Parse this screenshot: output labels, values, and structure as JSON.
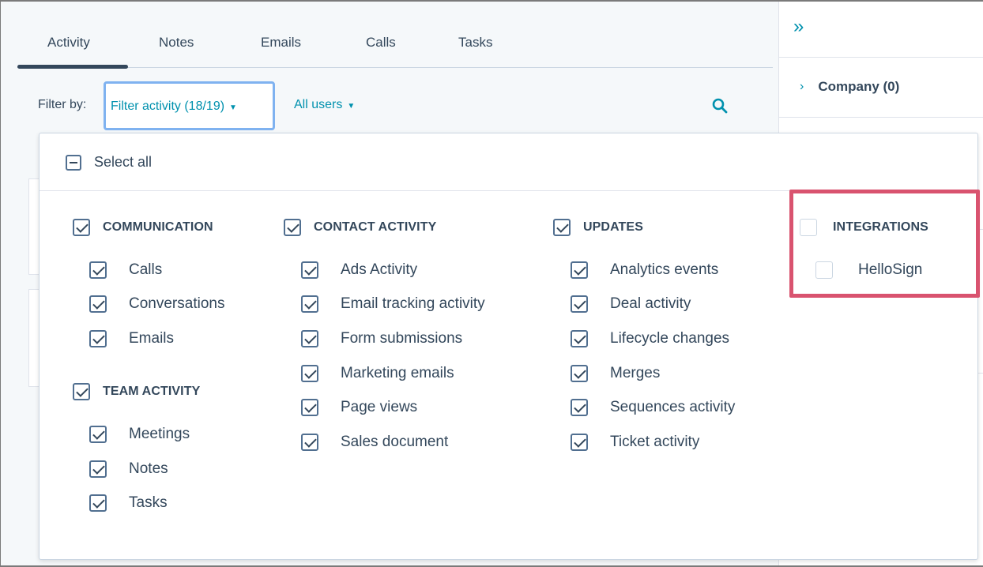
{
  "tabs": [
    "Activity",
    "Notes",
    "Emails",
    "Calls",
    "Tasks"
  ],
  "filter": {
    "label": "Filter by:",
    "activity": "Filter activity (18/19)",
    "users": "All users"
  },
  "sidebar": {
    "section_label": "Company (0)"
  },
  "panel": {
    "select_all": "Select all",
    "communication": {
      "title": "COMMUNICATION",
      "items": [
        "Calls",
        "Conversations",
        "Emails"
      ]
    },
    "team_activity": {
      "title": "TEAM ACTIVITY",
      "items": [
        "Meetings",
        "Notes",
        "Tasks"
      ]
    },
    "contact_activity": {
      "title": "CONTACT ACTIVITY",
      "items": [
        "Ads Activity",
        "Email tracking activity",
        "Form submissions",
        "Marketing emails",
        "Page views",
        "Sales document"
      ]
    },
    "updates": {
      "title": "UPDATES",
      "items": [
        "Analytics events",
        "Deal activity",
        "Lifecycle changes",
        "Merges",
        "Sequences activity",
        "Ticket activity"
      ]
    },
    "integrations": {
      "title": "INTEGRATIONS",
      "items": [
        "HelloSign"
      ]
    }
  },
  "colors": {
    "accent": "#0091ae",
    "text": "#33475b",
    "highlight": "#d9536f",
    "focus": "#7fb2f0"
  }
}
